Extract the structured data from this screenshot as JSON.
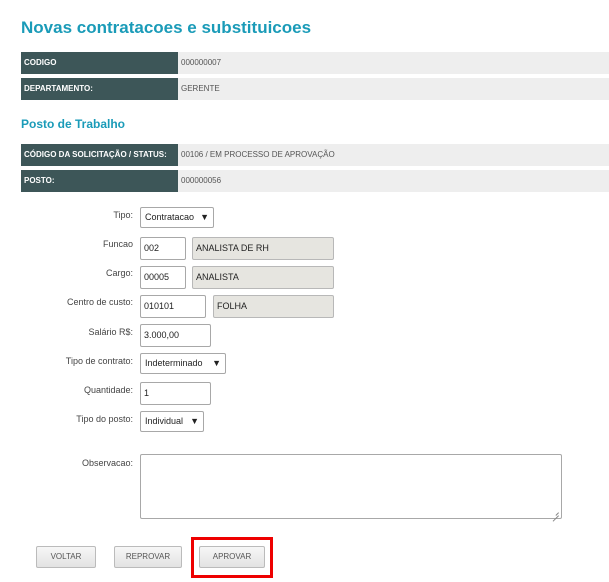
{
  "page": {
    "title": "Novas contratacoes e substituicoes",
    "section_title": "Posto de Trabalho"
  },
  "info": {
    "codigo": {
      "label": "CODIGO",
      "value": "000000007"
    },
    "departamento": {
      "label": "DEPARTAMENTO:",
      "value": "GERENTE"
    },
    "solicitacao": {
      "label": "CÓDIGO DA SOLICITAÇÃO / STATUS:",
      "value": "00106 / EM PROCESSO DE APROVAÇÃO"
    },
    "posto": {
      "label": "POSTO:",
      "value": "000000056"
    }
  },
  "form": {
    "tipo": {
      "label": "Tipo:",
      "value": "Contratacao"
    },
    "funcao": {
      "label": "Funcao",
      "code": "002",
      "desc": "ANALISTA DE RH"
    },
    "cargo": {
      "label": "Cargo:",
      "code": "00005",
      "desc": "ANALISTA"
    },
    "centro": {
      "label": "Centro de custo:",
      "code": "010101",
      "desc": "FOLHA"
    },
    "salario": {
      "label": "Salário R$:",
      "value": "3.000,00"
    },
    "tipo_contrato": {
      "label": "Tipo de contrato:",
      "value": "Indeterminado"
    },
    "quantidade": {
      "label": "Quantidade:",
      "value": "1"
    },
    "tipo_posto": {
      "label": "Tipo do posto:",
      "value": "Individual"
    },
    "observacao": {
      "label": "Observacao:",
      "value": ""
    }
  },
  "buttons": {
    "voltar": "VOLTAR",
    "reprovar": "REPROVAR",
    "aprovar": "APROVAR"
  },
  "colors": {
    "accent": "#1a9bb8",
    "label_bg": "#3d5658",
    "highlight": "#ee0000"
  }
}
